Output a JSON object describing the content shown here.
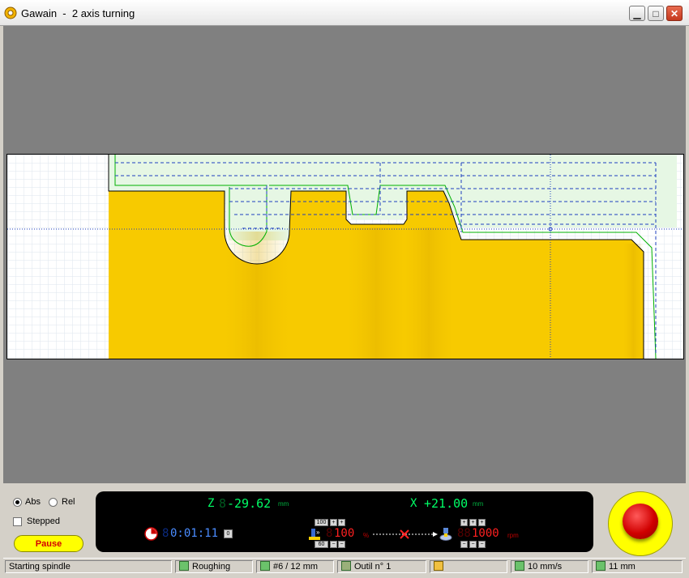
{
  "window": {
    "title": "Gawain  -  2 axis turning",
    "minimize_icon": "minimize-icon",
    "maximize_icon": "maximize-icon",
    "close_icon": "close-icon"
  },
  "colors": {
    "workspace": "#808080",
    "part": "#f5c800",
    "toolpath": "#1f3fbf",
    "contour": "#00a000",
    "dro_green": "#00ff66",
    "dro_red": "#ff2020",
    "pause_bg": "#ffff00",
    "estop": "#e00000"
  },
  "controls": {
    "abs_label": "Abs",
    "rel_label": "Rel",
    "abs_selected": true,
    "stepped_label": "Stepped",
    "stepped_checked": false,
    "pause_label": "Pause"
  },
  "dro": {
    "z_axis": "Z",
    "z_value": "-29.62",
    "z_unit": "mm",
    "x_axis": "X",
    "x_value": "+21.00",
    "x_unit": "mm",
    "timer": "0:01:11",
    "timer_reset": "0",
    "feed_top": "100",
    "feed_bottom": "60",
    "feed_value": "100",
    "feed_unit": "%",
    "speed_value": "1000",
    "speed_unit": "rpm"
  },
  "status": {
    "message": "Starting spindle",
    "mode": "Roughing",
    "pass": "#6 / 12 mm",
    "tool": "Outil n° 1",
    "feed": "10 mm/s",
    "depth": "11 mm"
  }
}
